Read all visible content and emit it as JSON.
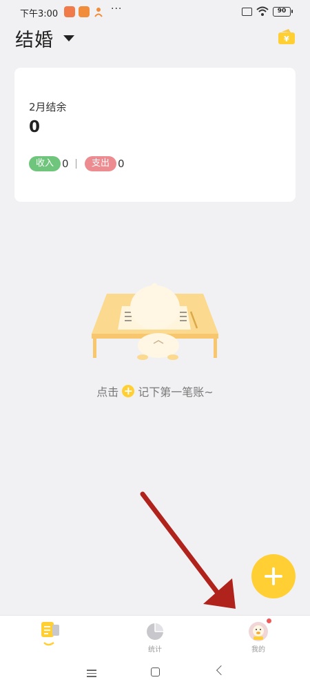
{
  "status_bar": {
    "time": "下午3:00",
    "dots": "···",
    "battery": "90"
  },
  "header": {
    "book_name": "结婚",
    "book_menu_icon": "caret-down-icon",
    "wallet_icon": "wallet-yen-icon",
    "wallet_icon_label": "¥"
  },
  "summary": {
    "balance_label": "2月结余",
    "balance_value": "0",
    "income_label": "收入",
    "income_value": "0",
    "expense_label": "支出",
    "expense_value": "0"
  },
  "empty_state": {
    "illustration": "duckling-at-desk-illustration",
    "hint_before": "点击",
    "hint_after": "记下第一笔账~"
  },
  "fab": {
    "icon": "plus-icon"
  },
  "bottom_nav": {
    "items": [
      {
        "label": "",
        "icon": "notebook-icon",
        "active": true
      },
      {
        "label": "统计",
        "icon": "pie-chart-icon"
      },
      {
        "label": "我的",
        "icon": "duck-avatar-icon",
        "badge": true
      }
    ]
  },
  "colors": {
    "accent": "#ffcf33",
    "income": "#6fc57b",
    "expense": "#ec8b90",
    "background": "#f1f1f4",
    "annotation_arrow": "#b0231d"
  }
}
